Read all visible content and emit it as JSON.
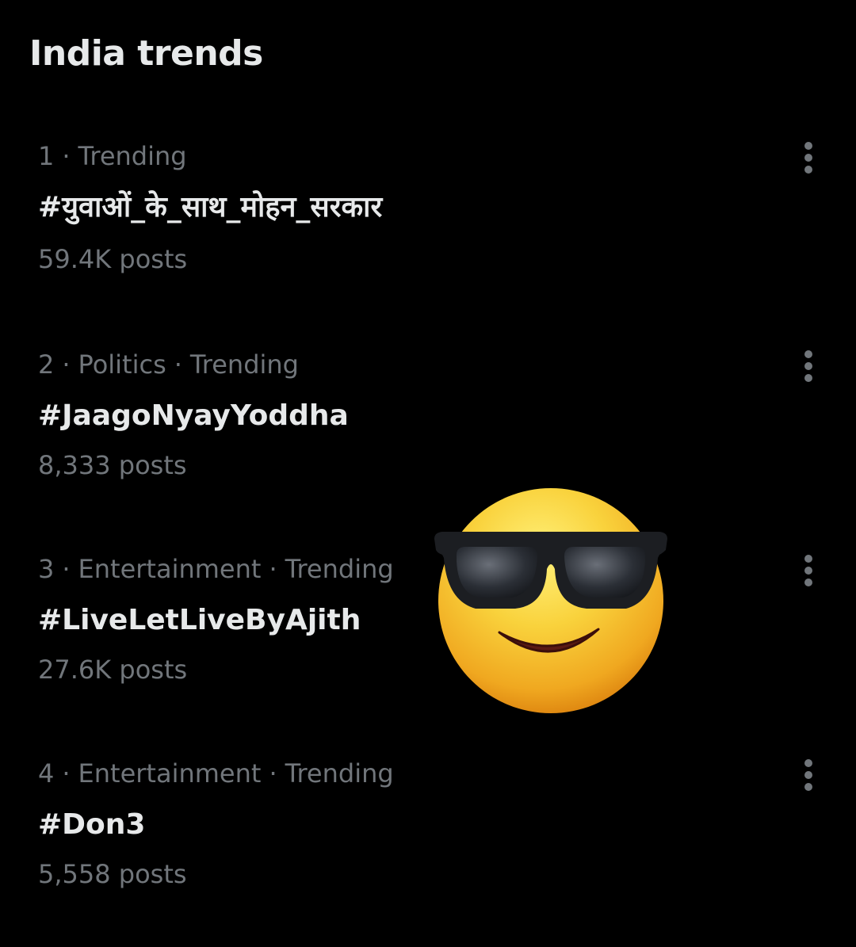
{
  "header": {
    "title": "India trends"
  },
  "trends": [
    {
      "rank": "1",
      "context": [
        "Trending"
      ],
      "name": "#युवाओं_के_साथ_मोहन_सरकार",
      "posts": "59.4K posts"
    },
    {
      "rank": "2",
      "context": [
        "Politics",
        "Trending"
      ],
      "name": "#JaagoNyayYoddha",
      "posts": "8,333 posts"
    },
    {
      "rank": "3",
      "context": [
        "Entertainment",
        "Trending"
      ],
      "name": "#LiveLetLiveByAjith",
      "posts": "27.6K posts"
    },
    {
      "rank": "4",
      "context": [
        "Entertainment",
        "Trending"
      ],
      "name": "#Don3",
      "posts": "5,558 posts"
    }
  ],
  "icons": {
    "more": "more-options-icon",
    "sticker": "smiling-face-with-sunglasses-emoji"
  },
  "colors": {
    "background": "#000000",
    "primary_text": "#e7e9ea",
    "secondary_text": "#71767b",
    "emoji_face": "#f7c531",
    "emoji_glasses": "#1a1d22"
  }
}
